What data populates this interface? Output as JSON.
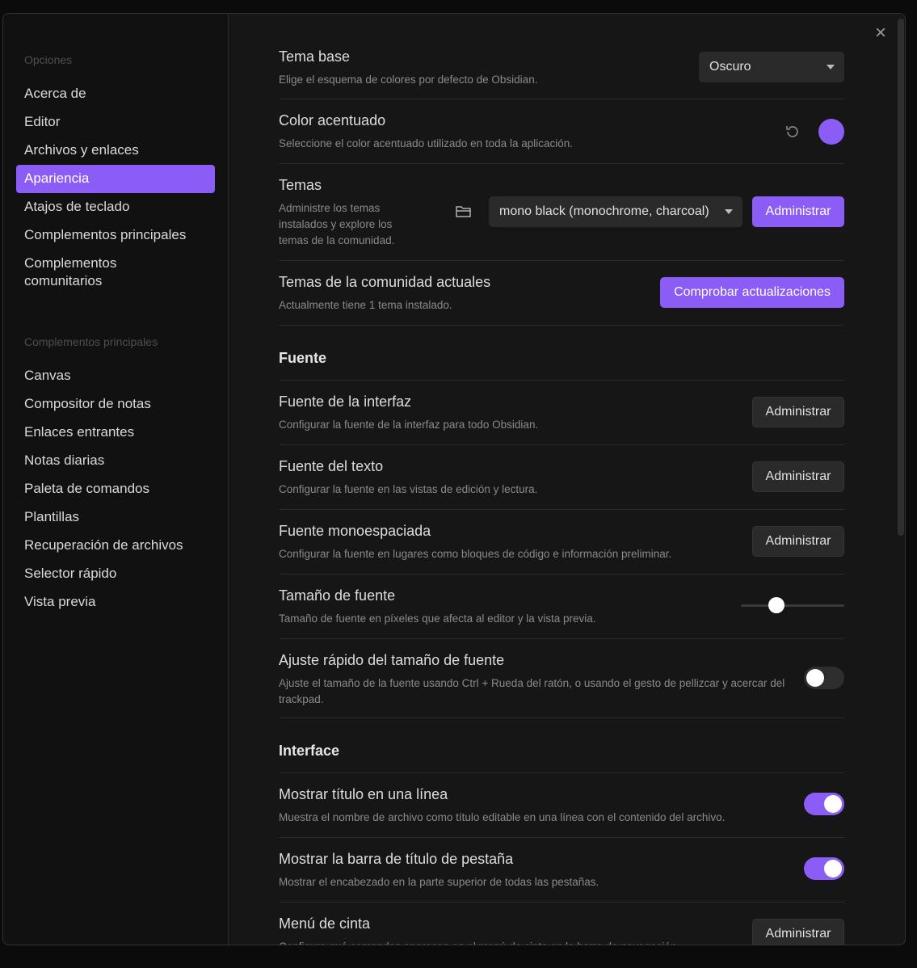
{
  "colors": {
    "accent": "#8b5cf6"
  },
  "sidebar": {
    "group1_title": "Opciones",
    "group1": [
      "Acerca de",
      "Editor",
      "Archivos y enlaces",
      "Apariencia",
      "Atajos de teclado",
      "Complementos principales",
      "Complementos comunitarios"
    ],
    "active": "Apariencia",
    "group2_title": "Complementos principales",
    "group2": [
      "Canvas",
      "Compositor de notas",
      "Enlaces entrantes",
      "Notas diarias",
      "Paleta de comandos",
      "Plantillas",
      "Recuperación de archivos",
      "Selector rápido",
      "Vista previa"
    ]
  },
  "settings": {
    "base_theme": {
      "name": "Tema base",
      "desc": "Elige el esquema de colores por defecto de Obsidian.",
      "value": "Oscuro"
    },
    "accent_color": {
      "name": "Color acentuado",
      "desc": "Seleccione el color acentuado utilizado en toda la aplicación."
    },
    "themes": {
      "name": "Temas",
      "desc": "Administre los temas instalados y explore los temas de la comunidad.",
      "value": "mono black (monochrome, charcoal)",
      "button": "Administrar"
    },
    "community_themes": {
      "name": "Temas de la comunidad actuales",
      "desc": "Actualmente tiene 1 tema instalado.",
      "button": "Comprobar actualizaciones"
    },
    "font_heading": "Fuente",
    "interface_font": {
      "name": "Fuente de la interfaz",
      "desc": "Configurar la fuente de la interfaz para todo Obsidian.",
      "button": "Administrar"
    },
    "text_font": {
      "name": "Fuente del texto",
      "desc": "Configurar la fuente en las vistas de edición y lectura.",
      "button": "Administrar"
    },
    "mono_font": {
      "name": "Fuente monoespaciada",
      "desc": "Configurar la fuente en lugares como bloques de código e información preliminar.",
      "button": "Administrar"
    },
    "font_size": {
      "name": "Tamaño de fuente",
      "desc": "Tamaño de fuente en píxeles que afecta al editor y la vista previa.",
      "level": 0.34
    },
    "quick_font": {
      "name": "Ajuste rápido del tamaño de fuente",
      "desc": "Ajuste el tamaño de la fuente usando Ctrl + Rueda del ratón, o usando el gesto de pellizcar y acercar del trackpad.",
      "enabled": false
    },
    "interface_heading": "Interface",
    "inline_title": {
      "name": "Mostrar título en una línea",
      "desc": "Muestra el nombre de archivo como título editable en una línea con el contenido del archivo.",
      "enabled": true
    },
    "tab_title_bar": {
      "name": "Mostrar la barra de título de pestaña",
      "desc": "Mostrar el encabezado en la parte superior de todas las pestañas.",
      "enabled": true
    },
    "ribbon_menu": {
      "name": "Menú de cinta",
      "desc": "Configura qué comandos aparecen en el menú de cinta en la barra de navegación.",
      "button": "Administrar"
    }
  }
}
